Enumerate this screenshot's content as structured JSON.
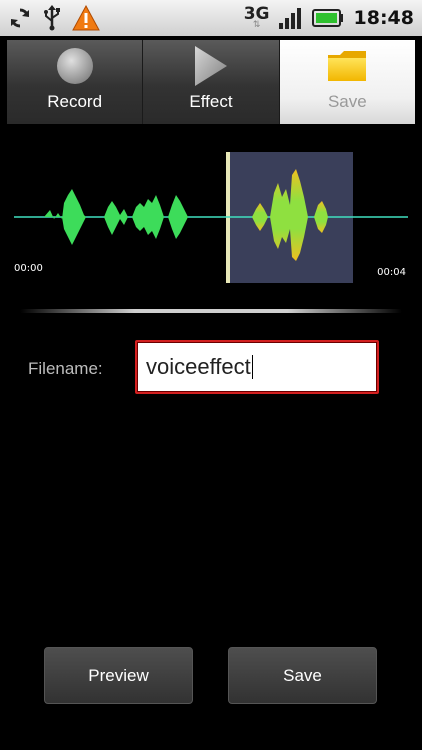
{
  "status_bar": {
    "network": "3G",
    "time": "18:48",
    "icons": [
      "sync-icon",
      "usb-icon",
      "warning-icon",
      "signal-icon",
      "battery-icon"
    ]
  },
  "tabs": [
    {
      "label": "Record",
      "icon": "record-icon",
      "active": false
    },
    {
      "label": "Effect",
      "icon": "play-icon",
      "active": false
    },
    {
      "label": "Save",
      "icon": "folder-icon",
      "active": true
    }
  ],
  "waveform": {
    "start_time": "00:00",
    "end_time": "00:04",
    "colors": {
      "wave": "#3ddc5a",
      "selection_bg": "#3a3f5a",
      "baseline": "#40e0c0"
    }
  },
  "form": {
    "filename_label": "Filename:",
    "filename_value": "voiceeffect"
  },
  "buttons": {
    "preview_label": "Preview",
    "save_label": "Save"
  },
  "colors": {
    "accent_red": "#d32020",
    "battery_green": "#2fc12f"
  }
}
